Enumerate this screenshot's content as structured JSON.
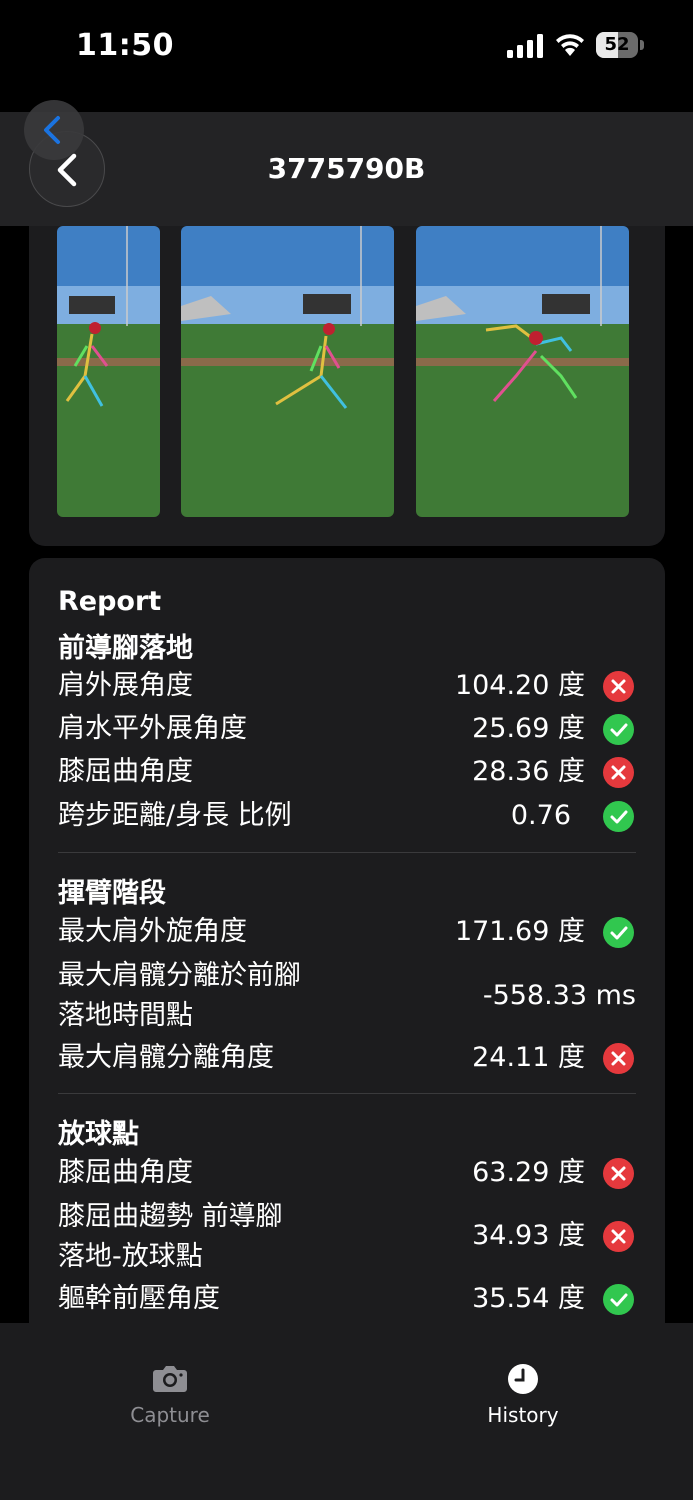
{
  "status_bar": {
    "time": "11:50",
    "battery": "52",
    "battery_level": 0.52
  },
  "nav": {
    "title": "3775790B",
    "back_icon": "chevron-left-icon"
  },
  "report": {
    "title": "Report",
    "sections": [
      {
        "title": "前導腳落地",
        "rows": [
          {
            "label": "肩外展角度",
            "value": "104.20 度",
            "status": "bad"
          },
          {
            "label": "肩水平外展角度",
            "value": "25.69 度",
            "status": "good"
          },
          {
            "label": "膝屈曲角度",
            "value": "28.36 度",
            "status": "bad"
          },
          {
            "label": "跨步距離/身長 比例",
            "value": "0.76",
            "status": "good"
          }
        ]
      },
      {
        "title": "揮臂階段",
        "rows": [
          {
            "label": "最大肩外旋角度",
            "value": "171.69 度",
            "status": "good"
          },
          {
            "label": "最大肩髖分離於前腳\n落地時間點",
            "value": "-558.33 ms",
            "status": "none"
          },
          {
            "label": "最大肩髖分離角度",
            "value": "24.11 度",
            "status": "bad"
          }
        ]
      },
      {
        "title": "放球點",
        "rows": [
          {
            "label": "膝屈曲角度",
            "value": "63.29 度",
            "status": "bad"
          },
          {
            "label": "膝屈曲趨勢 前導腳\n落地-放球點",
            "value": "34.93 度",
            "status": "bad"
          },
          {
            "label": "軀幹前壓角度",
            "value": "35.54 度",
            "status": "good"
          }
        ]
      }
    ]
  },
  "tabbar": {
    "capture": {
      "label": "Capture",
      "icon": "camera-icon"
    },
    "history": {
      "label": "History",
      "icon": "clock-icon"
    }
  },
  "colors": {
    "bad": "#e5393d",
    "good": "#31c74f",
    "card": "#1c1c1e"
  }
}
